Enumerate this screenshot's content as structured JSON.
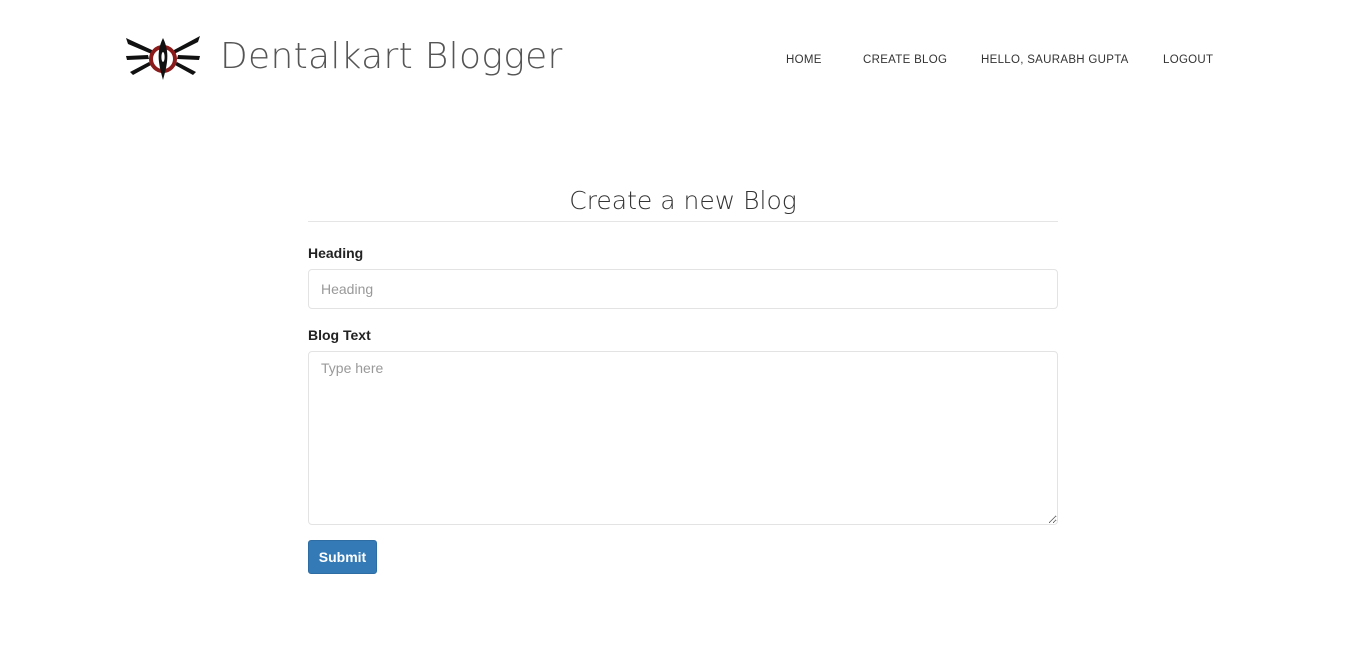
{
  "brand": {
    "logo_icon": "tooth-burst-logo",
    "name": "Dentalkart Blogger"
  },
  "nav": {
    "home": "HOME",
    "create_blog": "CREATE BLOG",
    "hello": "HELLO,  SAURABH GUPTA",
    "logout": "LOGOUT"
  },
  "form": {
    "title": "Create a new Blog",
    "heading_label": "Heading",
    "heading_value": "",
    "heading_placeholder": "Heading",
    "text_label": "Blog Text",
    "text_value": "",
    "text_placeholder": "Type here",
    "submit_label": "Submit"
  },
  "colors": {
    "primary_button": "#337ab7",
    "logo_red": "#8b1a1a",
    "logo_black": "#111111"
  }
}
